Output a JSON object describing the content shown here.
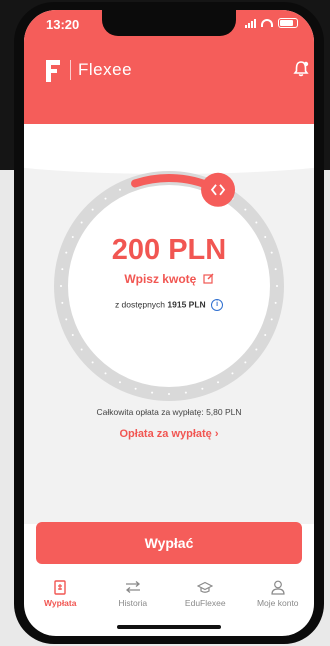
{
  "status": {
    "time": "13:20"
  },
  "app": {
    "name": "Flexee"
  },
  "colors": {
    "brand": "#f55d5a",
    "accent_text": "#f15652",
    "info": "#2f6fd0"
  },
  "dial": {
    "progress_fraction": 0.04
  },
  "amount": {
    "value": "200 PLN"
  },
  "enter_amount": {
    "label": "Wpisz kwotę"
  },
  "available": {
    "prefix": "z dostępnych",
    "value": "1915 PLN"
  },
  "fee": {
    "text": "Całkowita opłata za wypłatę: 5,80 PLN",
    "link_label": "Opłata za wypłatę ›"
  },
  "payout_button": {
    "label": "Wypłać"
  },
  "tabs": [
    {
      "label": "Wypłata",
      "icon": "document-icon",
      "active": true
    },
    {
      "label": "Historia",
      "icon": "transfer-arrows-icon",
      "active": false
    },
    {
      "label": "EduFlexee",
      "icon": "graduation-cap-icon",
      "active": false
    },
    {
      "label": "Moje konto",
      "icon": "user-icon",
      "active": false
    }
  ]
}
